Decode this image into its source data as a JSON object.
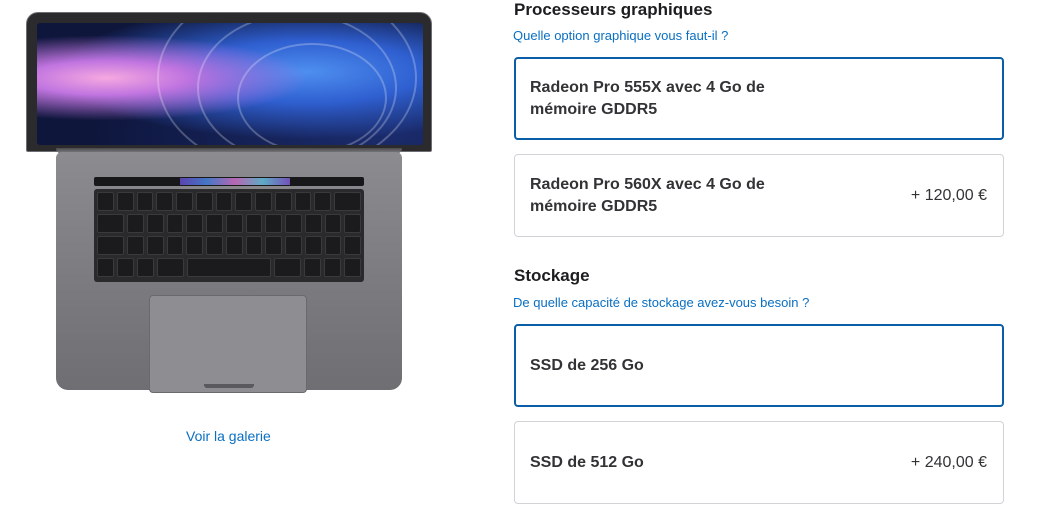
{
  "gallery": {
    "link_label": "Voir la galerie"
  },
  "graphics": {
    "title": "Processeurs graphiques",
    "help_link": "Quelle option graphique vous faut-il ?",
    "options": [
      {
        "name": "Radeon Pro 555X avec 4 Go de\nmémoire GDDR5",
        "price": "",
        "selected": true
      },
      {
        "name": "Radeon Pro 560X avec 4 Go de\nmémoire GDDR5",
        "price": "+ 120,00 €",
        "selected": false
      }
    ]
  },
  "storage": {
    "title": "Stockage",
    "help_link": "De quelle capacité de stockage avez-vous besoin ?",
    "options": [
      {
        "name": "SSD de 256 Go",
        "price": "",
        "selected": true
      },
      {
        "name": "SSD de 512 Go",
        "price": "+ 240,00 €",
        "selected": false
      }
    ]
  },
  "colors": {
    "link": "#0a6fc2",
    "selected_border": "#0a5ea8",
    "border": "#d2d2d7"
  }
}
